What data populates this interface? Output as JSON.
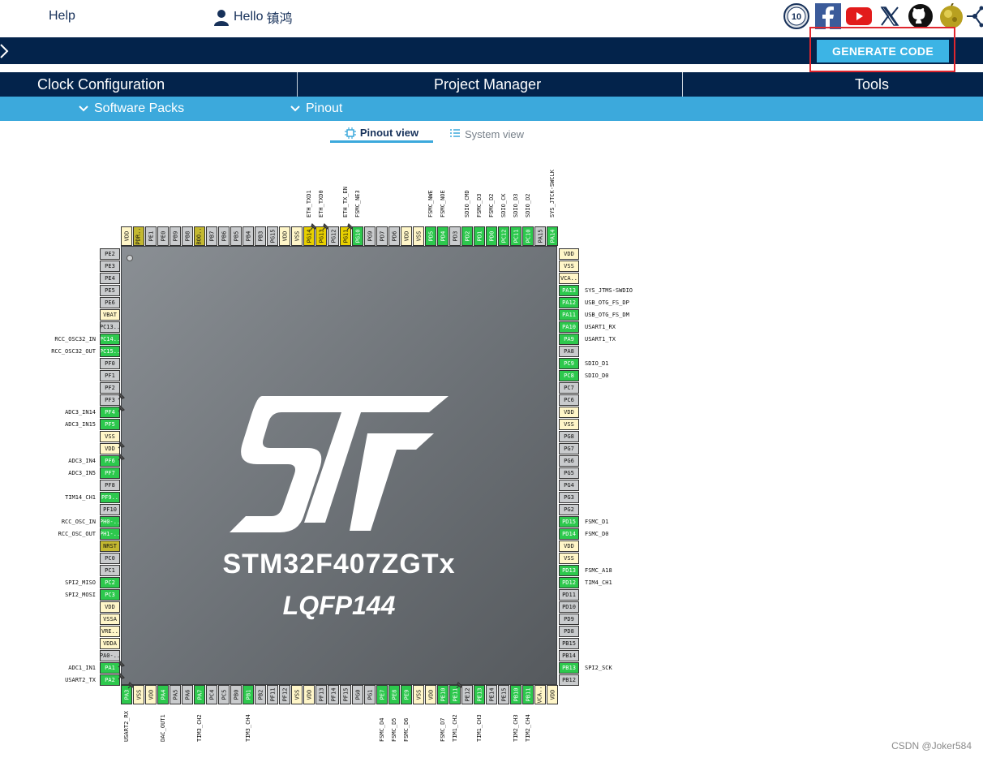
{
  "top": {
    "help": "Help",
    "greeting": "Hello",
    "username": "镇鸿",
    "icons": [
      "anniversary-badge-icon",
      "facebook-icon",
      "youtube-icon",
      "x-icon",
      "github-icon",
      "st-community-icon",
      "network-icon"
    ],
    "badge_text": "10"
  },
  "toolbar": {
    "generate_label": "GENERATE CODE"
  },
  "tabs": [
    {
      "label": "Clock Configuration"
    },
    {
      "label": "Project Manager"
    },
    {
      "label": "Tools"
    }
  ],
  "subnav": [
    {
      "label": "Software Packs"
    },
    {
      "label": "Pinout"
    }
  ],
  "views": {
    "pinout": "Pinout view",
    "system": "System view"
  },
  "chip": {
    "name": "STM32F407ZGTx",
    "package": "LQFP144"
  },
  "colors": {
    "navy": "#03234b",
    "accent": "#3ca9dc",
    "pin_green": "#2dc84d",
    "pin_yellow": "#e8d000",
    "frame_red": "#e0262e"
  },
  "pins": {
    "top": [
      {
        "n": "VDD",
        "c": "power"
      },
      {
        "n": "PDR..",
        "c": "olive"
      },
      {
        "n": "PE1",
        "c": "gray"
      },
      {
        "n": "PE0",
        "c": "gray"
      },
      {
        "n": "PB9",
        "c": "gray"
      },
      {
        "n": "PB8",
        "c": "gray"
      },
      {
        "n": "BOO..",
        "c": "olive"
      },
      {
        "n": "PB7",
        "c": "gray"
      },
      {
        "n": "PB6",
        "c": "gray"
      },
      {
        "n": "PB5",
        "c": "gray"
      },
      {
        "n": "PB4",
        "c": "gray"
      },
      {
        "n": "PB3",
        "c": "gray"
      },
      {
        "n": "PG15",
        "c": "gray"
      },
      {
        "n": "VDD",
        "c": "power"
      },
      {
        "n": "VSS",
        "c": "power"
      },
      {
        "n": "PG14",
        "c": "yellow",
        "s": "ETH_TXD1",
        "pinned": true
      },
      {
        "n": "PG13",
        "c": "yellow",
        "s": "ETH_TXD0",
        "pinned": true
      },
      {
        "n": "PG12",
        "c": "gray"
      },
      {
        "n": "PG11",
        "c": "yellow",
        "s": "ETH_TX_EN",
        "pinned": true
      },
      {
        "n": "PG10",
        "c": "green",
        "s": "FSMC_NE3"
      },
      {
        "n": "PG9",
        "c": "gray"
      },
      {
        "n": "PD7",
        "c": "gray"
      },
      {
        "n": "PD6",
        "c": "gray"
      },
      {
        "n": "VDD",
        "c": "power"
      },
      {
        "n": "VSS",
        "c": "power"
      },
      {
        "n": "PD5",
        "c": "green",
        "s": "FSMC_NWE"
      },
      {
        "n": "PD4",
        "c": "green",
        "s": "FSMC_NOE"
      },
      {
        "n": "PD3",
        "c": "gray"
      },
      {
        "n": "PD2",
        "c": "green",
        "s": "SDIO_CMD"
      },
      {
        "n": "PD1",
        "c": "green",
        "s": "FSMC_D3"
      },
      {
        "n": "PD0",
        "c": "green",
        "s": "FSMC_D2"
      },
      {
        "n": "PC12",
        "c": "green",
        "s": "SDIO_CK"
      },
      {
        "n": "PC11",
        "c": "green",
        "s": "SDIO_D3"
      },
      {
        "n": "PC10",
        "c": "green",
        "s": "SDIO_D2"
      },
      {
        "n": "PA15",
        "c": "gray"
      },
      {
        "n": "PA14",
        "c": "green",
        "s": "SYS_JTCK-SWCLK"
      }
    ],
    "left": [
      {
        "n": "PE2",
        "c": "gray"
      },
      {
        "n": "PE3",
        "c": "gray"
      },
      {
        "n": "PE4",
        "c": "gray"
      },
      {
        "n": "PE5",
        "c": "gray"
      },
      {
        "n": "PE6",
        "c": "gray"
      },
      {
        "n": "VBAT",
        "c": "power"
      },
      {
        "n": "PC13..",
        "c": "gray"
      },
      {
        "n": "PC14..",
        "c": "green",
        "s": "RCC_OSC32_IN"
      },
      {
        "n": "PC15..",
        "c": "green",
        "s": "RCC_OSC32_OUT"
      },
      {
        "n": "PF0",
        "c": "gray"
      },
      {
        "n": "PF1",
        "c": "gray"
      },
      {
        "n": "PF2",
        "c": "gray"
      },
      {
        "n": "PF3",
        "c": "gray",
        "pinned": true
      },
      {
        "n": "PF4",
        "c": "green",
        "s": "ADC3_IN14",
        "pinned": true
      },
      {
        "n": "PF5",
        "c": "green",
        "s": "ADC3_IN15"
      },
      {
        "n": "VSS",
        "c": "power"
      },
      {
        "n": "VDD",
        "c": "power",
        "pinned": true
      },
      {
        "n": "PF6",
        "c": "green",
        "s": "ADC3_IN4",
        "pinned": true
      },
      {
        "n": "PF7",
        "c": "green",
        "s": "ADC3_IN5"
      },
      {
        "n": "PF8",
        "c": "gray"
      },
      {
        "n": "PF9..",
        "c": "green",
        "s": "TIM14_CH1"
      },
      {
        "n": "PF10",
        "c": "gray"
      },
      {
        "n": "PH0-..",
        "c": "green",
        "s": "RCC_OSC_IN"
      },
      {
        "n": "PH1-..",
        "c": "green",
        "s": "RCC_OSC_OUT"
      },
      {
        "n": "NRST",
        "c": "olive"
      },
      {
        "n": "PC0",
        "c": "gray"
      },
      {
        "n": "PC1",
        "c": "gray"
      },
      {
        "n": "PC2",
        "c": "green",
        "s": "SPI2_MISO"
      },
      {
        "n": "PC3",
        "c": "green",
        "s": "SPI2_MOSI"
      },
      {
        "n": "VDD",
        "c": "power"
      },
      {
        "n": "VSSA",
        "c": "power"
      },
      {
        "n": "VRE..",
        "c": "power"
      },
      {
        "n": "VDDA",
        "c": "power"
      },
      {
        "n": "PA0-..",
        "c": "gray"
      },
      {
        "n": "PA1",
        "c": "green",
        "s": "ADC1_IN1",
        "pinned": true
      },
      {
        "n": "PA2",
        "c": "green",
        "s": "USART2_TX",
        "pinned": true
      }
    ],
    "right": [
      {
        "n": "VDD",
        "c": "power"
      },
      {
        "n": "VSS",
        "c": "power"
      },
      {
        "n": "VCA..",
        "c": "power"
      },
      {
        "n": "PA13",
        "c": "green",
        "s": "SYS_JTMS-SWDIO"
      },
      {
        "n": "PA12",
        "c": "green",
        "s": "USB_OTG_FS_DP"
      },
      {
        "n": "PA11",
        "c": "green",
        "s": "USB_OTG_FS_DM"
      },
      {
        "n": "PA10",
        "c": "green",
        "s": "USART1_RX"
      },
      {
        "n": "PA9",
        "c": "green",
        "s": "USART1_TX"
      },
      {
        "n": "PA8",
        "c": "gray"
      },
      {
        "n": "PC9",
        "c": "green",
        "s": "SDIO_D1"
      },
      {
        "n": "PC8",
        "c": "green",
        "s": "SDIO_D0"
      },
      {
        "n": "PC7",
        "c": "gray"
      },
      {
        "n": "PC6",
        "c": "gray"
      },
      {
        "n": "VDD",
        "c": "power"
      },
      {
        "n": "VSS",
        "c": "power"
      },
      {
        "n": "PG8",
        "c": "gray"
      },
      {
        "n": "PG7",
        "c": "gray"
      },
      {
        "n": "PG6",
        "c": "gray"
      },
      {
        "n": "PG5",
        "c": "gray"
      },
      {
        "n": "PG4",
        "c": "gray"
      },
      {
        "n": "PG3",
        "c": "gray"
      },
      {
        "n": "PG2",
        "c": "gray"
      },
      {
        "n": "PD15",
        "c": "green",
        "s": "FSMC_D1"
      },
      {
        "n": "PD14",
        "c": "green",
        "s": "FSMC_D0"
      },
      {
        "n": "VDD",
        "c": "power"
      },
      {
        "n": "VSS",
        "c": "power"
      },
      {
        "n": "PD13",
        "c": "green",
        "s": "FSMC_A18"
      },
      {
        "n": "PD12",
        "c": "green",
        "s": "TIM4_CH1"
      },
      {
        "n": "PD11",
        "c": "gray"
      },
      {
        "n": "PD10",
        "c": "gray"
      },
      {
        "n": "PD9",
        "c": "gray"
      },
      {
        "n": "PD8",
        "c": "gray"
      },
      {
        "n": "PB15",
        "c": "gray"
      },
      {
        "n": "PB14",
        "c": "gray"
      },
      {
        "n": "PB13",
        "c": "green",
        "s": "SPI2_SCK"
      },
      {
        "n": "PB12",
        "c": "gray"
      }
    ],
    "bottom": [
      {
        "n": "PA3",
        "c": "green",
        "s": "USART2_RX",
        "pinned": true
      },
      {
        "n": "VSS",
        "c": "power"
      },
      {
        "n": "VDD",
        "c": "power"
      },
      {
        "n": "PA4",
        "c": "green",
        "s": "DAC_OUT1"
      },
      {
        "n": "PA5",
        "c": "gray"
      },
      {
        "n": "PA6",
        "c": "gray"
      },
      {
        "n": "PA7",
        "c": "green",
        "s": "TIM3_CH2"
      },
      {
        "n": "PC4",
        "c": "gray"
      },
      {
        "n": "PC5",
        "c": "gray"
      },
      {
        "n": "PB0",
        "c": "gray"
      },
      {
        "n": "PB1",
        "c": "green",
        "s": "TIM3_CH4"
      },
      {
        "n": "PB2",
        "c": "gray"
      },
      {
        "n": "PF11",
        "c": "gray"
      },
      {
        "n": "PF12",
        "c": "gray"
      },
      {
        "n": "VSS",
        "c": "power"
      },
      {
        "n": "VDD",
        "c": "power"
      },
      {
        "n": "PF13",
        "c": "gray"
      },
      {
        "n": "PF14",
        "c": "gray"
      },
      {
        "n": "PF15",
        "c": "gray"
      },
      {
        "n": "PG0",
        "c": "gray"
      },
      {
        "n": "PG1",
        "c": "gray"
      },
      {
        "n": "PE7",
        "c": "green",
        "s": "FSMC_D4"
      },
      {
        "n": "PE8",
        "c": "green",
        "s": "FSMC_D5"
      },
      {
        "n": "PE9",
        "c": "green",
        "s": "FSMC_D6"
      },
      {
        "n": "VSS",
        "c": "power"
      },
      {
        "n": "VDD",
        "c": "power"
      },
      {
        "n": "PE10",
        "c": "green",
        "s": "FSMC_D7"
      },
      {
        "n": "PE11",
        "c": "green",
        "s": "TIM1_CH2",
        "pinned": true
      },
      {
        "n": "PE12",
        "c": "gray"
      },
      {
        "n": "PE13",
        "c": "green",
        "s": "TIM1_CH3"
      },
      {
        "n": "PE14",
        "c": "gray"
      },
      {
        "n": "PE15",
        "c": "gray"
      },
      {
        "n": "PB10",
        "c": "green",
        "s": "TIM2_CH3"
      },
      {
        "n": "PB11",
        "c": "green",
        "s": "TIM2_CH4"
      },
      {
        "n": "VCA..",
        "c": "power"
      },
      {
        "n": "VDD",
        "c": "power"
      }
    ]
  },
  "watermark": "CSDN @Joker584"
}
